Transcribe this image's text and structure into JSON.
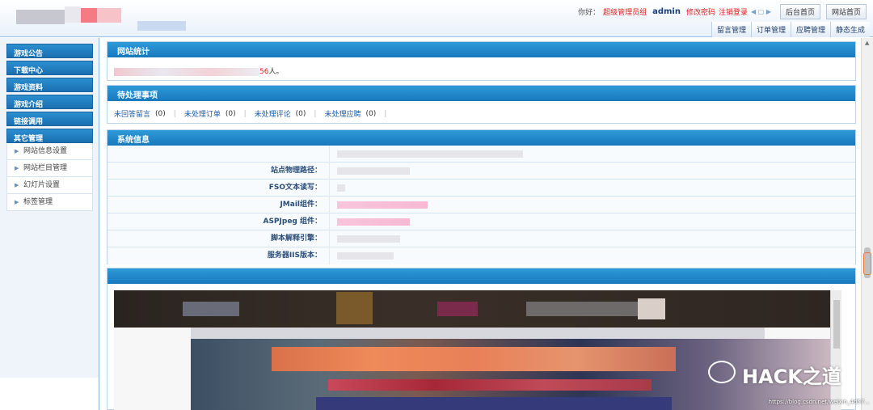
{
  "header": {
    "greeting": "你好：",
    "user_group": "超级管理员组",
    "username": "admin",
    "change_password": "修改密码",
    "logout": "注销登录",
    "arrows": "◀ ▢ ▶",
    "buttons": [
      "后台首页",
      "网站首页"
    ],
    "menu": [
      "留言管理",
      "订单管理",
      "应聘管理",
      "静态生成"
    ]
  },
  "sidebar": {
    "sections": [
      "游戏公告",
      "下载中心",
      "游戏资料",
      "游戏介绍",
      "链接调用",
      "其它管理"
    ],
    "sub_items": [
      "网站信息设置",
      "网站栏目管理",
      "幻灯片设置",
      "标签管理"
    ]
  },
  "stats": {
    "title": "网站统计",
    "count_suffix": "56",
    "unit": "人。"
  },
  "pending": {
    "title": "待处理事项",
    "items": [
      {
        "label": "未回答留言",
        "count": "(0)"
      },
      {
        "label": "未处理订单",
        "count": "(0)"
      },
      {
        "label": "未处理评论",
        "count": "(0)"
      },
      {
        "label": "未处理应聘",
        "count": "(0)"
      }
    ],
    "separator": "|"
  },
  "system": {
    "title": "系统信息",
    "rows": [
      "",
      "站点物理路径：",
      "FSO文本读写：",
      "JMail组件：",
      "ASPJpeg 组件：",
      "脚本解释引擎：",
      "服务器IIS版本："
    ]
  },
  "watermark": {
    "text": "HACK之道",
    "url": "https://blog.csdn.net/weixin_4d57..."
  },
  "colors": {
    "panel_title": "#1a7fc1",
    "link": "#1f5ea8",
    "alert": "#e0211e"
  }
}
